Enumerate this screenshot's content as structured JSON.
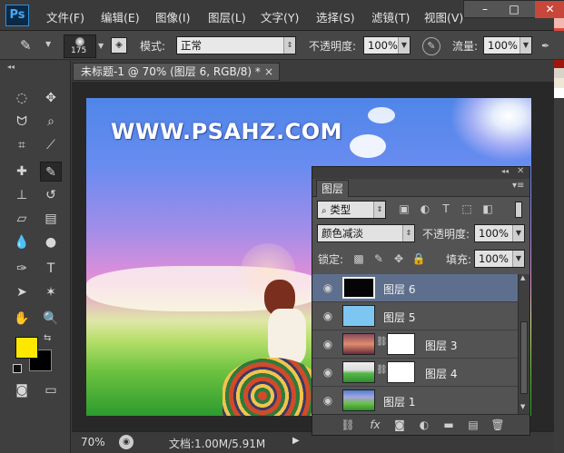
{
  "app": {
    "logo": "Ps"
  },
  "menu": [
    "文件(F)",
    "编辑(E)",
    "图像(I)",
    "图层(L)",
    "文字(Y)",
    "选择(S)",
    "滤镜(T)",
    "视图(V)"
  ],
  "window_controls": {
    "minimize": "–",
    "maximize": "□",
    "close": "✕"
  },
  "options": {
    "brush_size": "175",
    "mode_label": "模式:",
    "mode_value": "正常",
    "opacity_label": "不透明度:",
    "opacity_value": "100%",
    "flow_label": "流量:",
    "flow_value": "100%"
  },
  "document": {
    "tab_title": "未标题-1 @ 70% (图层 6, RGB/8) *",
    "tab_close": "×",
    "watermark": "WWW.PSAHZ.COM"
  },
  "status": {
    "zoom": "70%",
    "doc_info": "文档:1.00M/5.91M"
  },
  "layers_panel": {
    "tab": "图层",
    "filter_kind": "类型",
    "blend_mode": "颜色减淡",
    "opacity_label": "不透明度:",
    "opacity_value": "100%",
    "lock_label": "锁定:",
    "fill_label": "填充:",
    "fill_value": "100%",
    "layers": [
      {
        "name": "图层 6",
        "selected": true,
        "thumb": "#050508",
        "has_mask": false
      },
      {
        "name": "图层 5",
        "selected": false,
        "thumb": "#7ec6f2",
        "has_mask": false
      },
      {
        "name": "图层 3",
        "selected": false,
        "thumb": "gradient-sunset",
        "has_mask": true
      },
      {
        "name": "图层 4",
        "selected": false,
        "thumb": "grass-transparent",
        "has_mask": true
      },
      {
        "name": "图层 1",
        "selected": false,
        "thumb": "photo",
        "has_mask": false
      }
    ]
  },
  "colors": {
    "foreground": "#ffe800",
    "background": "#000000",
    "accent_selected_layer": "#5d6f8c",
    "swatch_reds": [
      "#f2b8b2",
      "#e04a3c",
      "#cc2a1f",
      "#b91d15",
      "#9f160f",
      "#d9d4c8",
      "#f0e6d6",
      "#ffffff"
    ]
  }
}
